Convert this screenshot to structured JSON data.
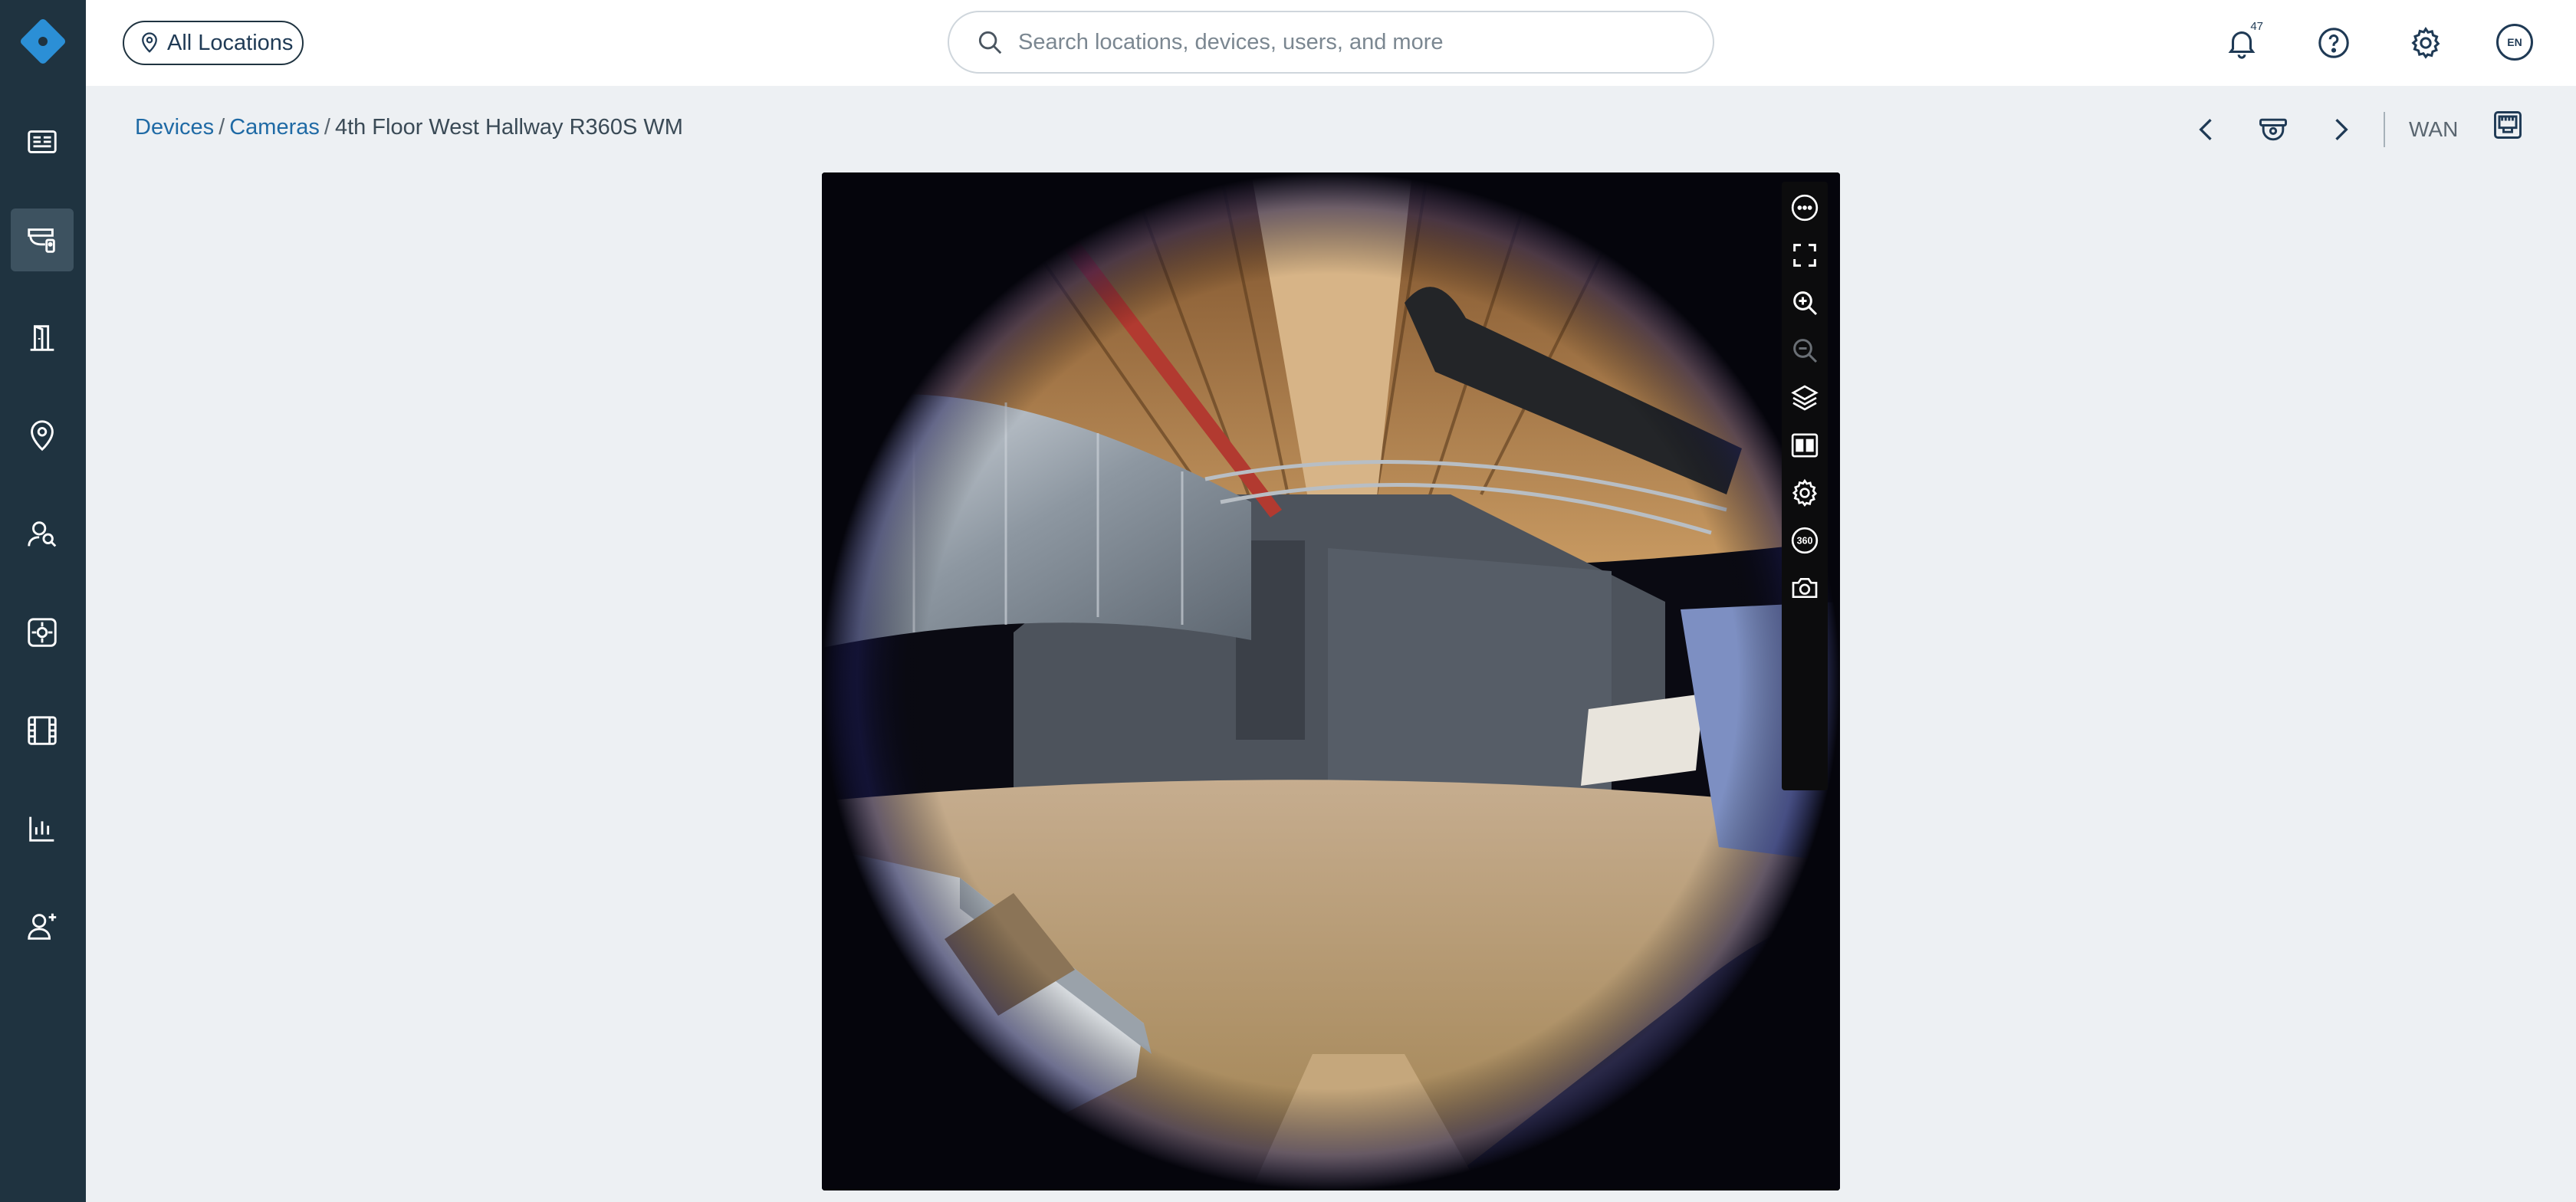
{
  "app": {
    "accent": "#1f3a55",
    "sidebar_bg": "#1f3340",
    "logo_color": "#2b8fd6"
  },
  "sidebar": {
    "items": [
      {
        "icon": "dashboard-icon",
        "active": false
      },
      {
        "icon": "camera-devices-icon",
        "active": true
      },
      {
        "icon": "door-access-icon",
        "active": false
      },
      {
        "icon": "location-pin-icon",
        "active": false
      },
      {
        "icon": "people-search-icon",
        "active": false
      },
      {
        "icon": "sensor-icon",
        "active": false
      },
      {
        "icon": "film-archive-icon",
        "active": false
      },
      {
        "icon": "reports-chart-icon",
        "active": false
      },
      {
        "icon": "add-user-icon",
        "active": false
      }
    ]
  },
  "topbar": {
    "location_button": "All Locations",
    "search_placeholder": "Search locations, devices, users, and more",
    "notification_count": "47",
    "language": "EN"
  },
  "breadcrumb": {
    "devices": "Devices",
    "cameras": "Cameras",
    "current": "4th Floor West Hallway R360S WM"
  },
  "header_controls": {
    "network_label": "WAN"
  },
  "video_toolbar": {
    "tools": [
      "more-options-icon",
      "fullscreen-icon",
      "zoom-in-icon",
      "zoom-out-icon",
      "layers-icon",
      "split-view-icon",
      "settings-icon",
      "360-view-icon",
      "snapshot-icon"
    ]
  }
}
